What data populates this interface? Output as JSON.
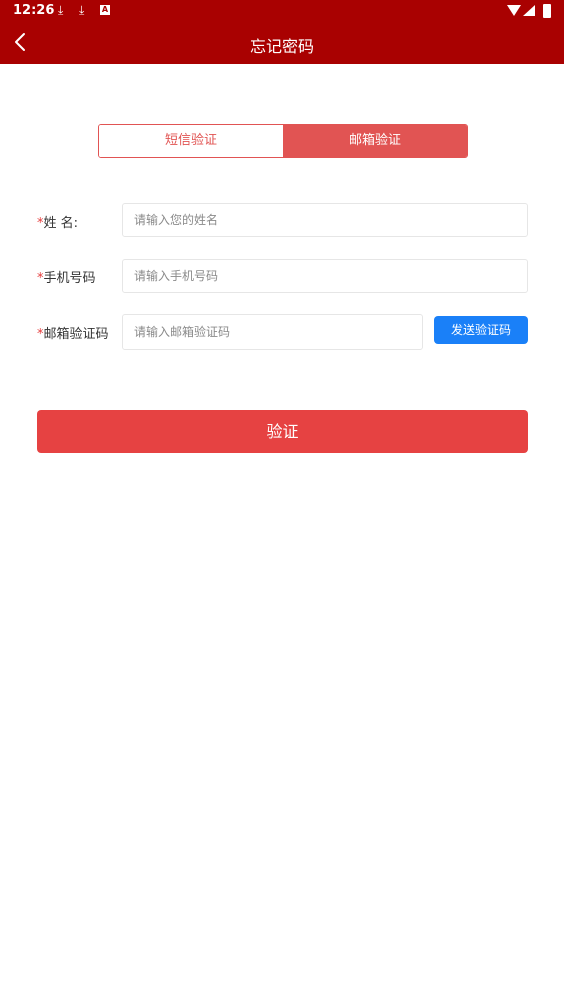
{
  "status_bar": {
    "time": "12:26",
    "icons": [
      "download-icon",
      "download-icon",
      "a-icon",
      "wifi-icon",
      "signal-icon",
      "battery-icon"
    ]
  },
  "header": {
    "title": "忘记密码",
    "back_icon": "chevron-left-icon"
  },
  "tabs": [
    {
      "label": "短信验证",
      "active": false
    },
    {
      "label": "邮箱验证",
      "active": true
    }
  ],
  "form": {
    "required_mark": "*",
    "name": {
      "label": "姓 名:",
      "placeholder": "请输入您的姓名",
      "value": ""
    },
    "phone": {
      "label": "手机号码",
      "placeholder": "请输入手机号码",
      "value": ""
    },
    "email_code": {
      "label": "邮箱验证码",
      "placeholder": "请输入邮箱验证码",
      "value": ""
    },
    "send_code_label": "发送验证码"
  },
  "submit": {
    "label": "验证"
  },
  "colors": {
    "header_bg": "#a90101",
    "tab_accent": "#e15453",
    "required_star": "#e53b3b",
    "send_button": "#1a80f8",
    "submit_button": "#e64242"
  }
}
